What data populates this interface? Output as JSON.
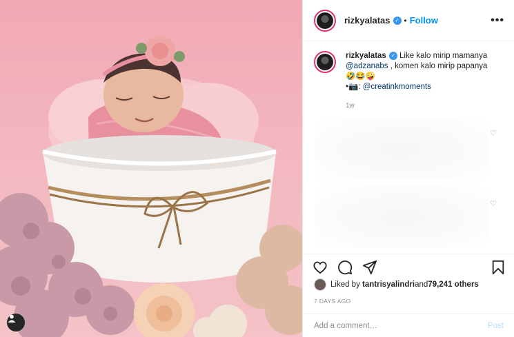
{
  "post": {
    "username": "rizkyalatas",
    "verified_badge": "✓",
    "separator": "•",
    "follow_label": "Follow",
    "more_label": "•••",
    "caption": {
      "username": "rizkyalatas",
      "text_1": " Like kalo mirip mamanya ",
      "mention_1": "@adzanabs",
      "text_2": " , komen kalo mirip papanya 🤣😂🤪",
      "line_2_prefix": "•📷: ",
      "mention_2": "@creatinkmoments",
      "time": "1w"
    },
    "likes": {
      "prefix": "Liked by ",
      "liker": "tantrisyalindri",
      "middle": " and ",
      "count": "79,241 others"
    },
    "posted_ago": "7 DAYS AGO",
    "comment_placeholder": "Add a comment…",
    "post_label": "Post"
  },
  "icons": {
    "header_more": "more-options-icon",
    "like": "heart-icon",
    "comment": "comment-icon",
    "share": "share-icon",
    "save": "bookmark-icon",
    "user_tag": "user-tag-icon"
  },
  "colors": {
    "accent": "#0095f6",
    "verified": "#3897f0",
    "photo_background": "#f1a9b4"
  }
}
